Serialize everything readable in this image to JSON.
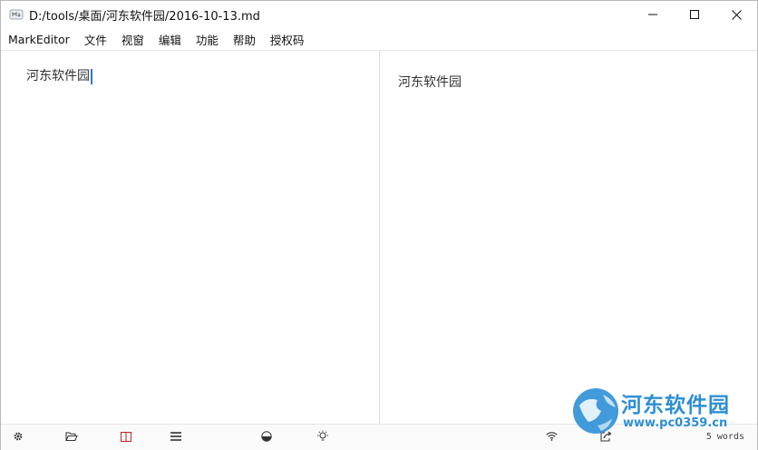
{
  "window": {
    "title": "D:/tools/桌面/河东软件园/2016-10-13.md"
  },
  "menu": {
    "items": [
      "MarkEditor",
      "文件",
      "视窗",
      "编辑",
      "功能",
      "帮助",
      "授权码"
    ]
  },
  "editor": {
    "content": "河东软件园"
  },
  "preview": {
    "content": "河东软件园"
  },
  "statusbar": {
    "icons": [
      "gear-icon",
      "open-folder-icon",
      "split-view-icon",
      "menu-lines-icon",
      "theme-icon",
      "lightbulb-icon",
      "wifi-icon",
      "export-icon"
    ],
    "word_count": "5 words",
    "accent_color": "#cc2222"
  },
  "watermark": {
    "line1": "河东软件园",
    "line2": "www.pc0359.cn",
    "color": "#2c8fd6"
  }
}
